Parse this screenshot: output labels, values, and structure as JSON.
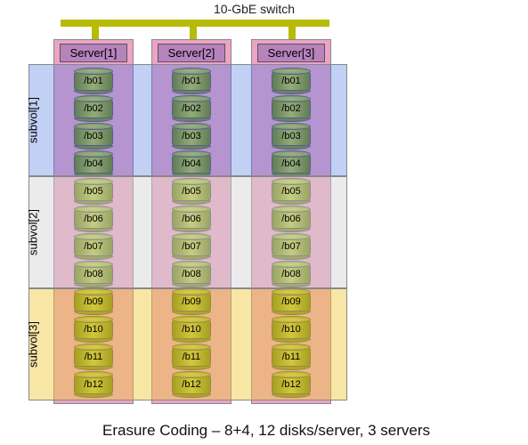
{
  "switch": {
    "label": "10-GbE switch"
  },
  "servers": [
    {
      "label": "Server[1]"
    },
    {
      "label": "Server[2]"
    },
    {
      "label": "Server[3]"
    }
  ],
  "disks": [
    "/b01",
    "/b02",
    "/b03",
    "/b04",
    "/b05",
    "/b06",
    "/b07",
    "/b08",
    "/b09",
    "/b10",
    "/b11",
    "/b12"
  ],
  "subvols": [
    {
      "label": "subvol[1]"
    },
    {
      "label": "subvol[2]"
    },
    {
      "label": "subvol[3]"
    }
  ],
  "caption": "Erasure Coding – 8+4, 12 disks/server, 3 servers",
  "chart_data": {
    "type": "table",
    "title": "Erasure Coding – 8+4, 12 disks/server, 3 servers",
    "network": "10-GbE switch",
    "servers": 3,
    "disks_per_server": 12,
    "erasure_scheme": "8+4",
    "subvolumes": [
      {
        "name": "subvol[1]",
        "disk_range": [
          "/b01",
          "/b02",
          "/b03",
          "/b04"
        ],
        "servers": [
          "Server[1]",
          "Server[2]",
          "Server[3]"
        ]
      },
      {
        "name": "subvol[2]",
        "disk_range": [
          "/b05",
          "/b06",
          "/b07",
          "/b08"
        ],
        "servers": [
          "Server[1]",
          "Server[2]",
          "Server[3]"
        ]
      },
      {
        "name": "subvol[3]",
        "disk_range": [
          "/b09",
          "/b10",
          "/b11",
          "/b12"
        ],
        "servers": [
          "Server[1]",
          "Server[2]",
          "Server[3]"
        ]
      }
    ],
    "layout": {
      "Server[1]": [
        "/b01",
        "/b02",
        "/b03",
        "/b04",
        "/b05",
        "/b06",
        "/b07",
        "/b08",
        "/b09",
        "/b10",
        "/b11",
        "/b12"
      ],
      "Server[2]": [
        "/b01",
        "/b02",
        "/b03",
        "/b04",
        "/b05",
        "/b06",
        "/b07",
        "/b08",
        "/b09",
        "/b10",
        "/b11",
        "/b12"
      ],
      "Server[3]": [
        "/b01",
        "/b02",
        "/b03",
        "/b04",
        "/b05",
        "/b06",
        "/b07",
        "/b08",
        "/b09",
        "/b10",
        "/b11",
        "/b12"
      ]
    }
  }
}
